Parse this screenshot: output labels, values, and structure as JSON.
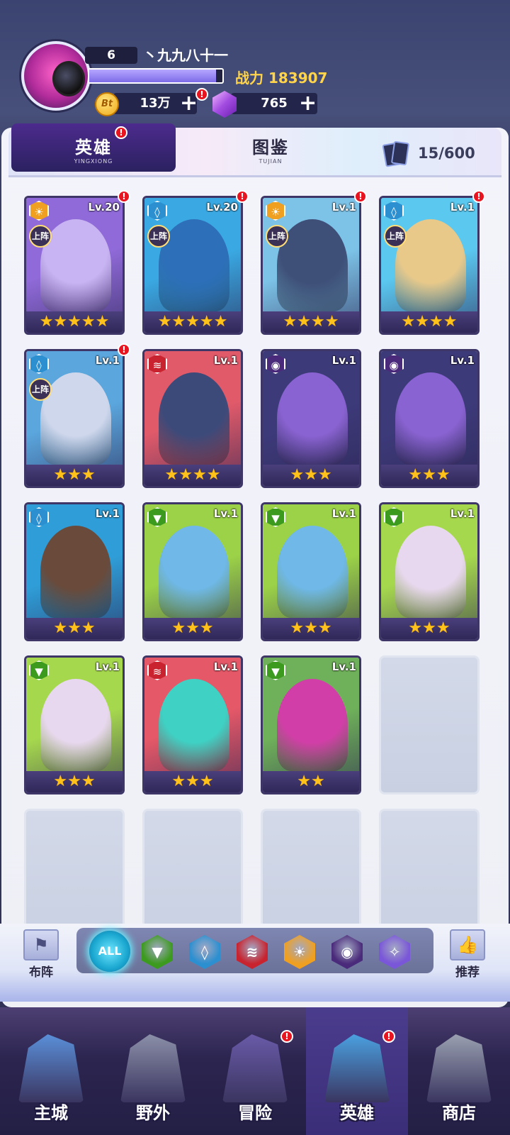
{
  "player": {
    "level": "6",
    "name": "丶九九八十一",
    "xp_fraction": 0.95,
    "power_label": "战力",
    "power_value": "183907",
    "coins": "13万",
    "gems": "765",
    "coin_symbol": "Bt",
    "plus": "+"
  },
  "tabs": {
    "heroes": "英雄",
    "heroes_sub": "YINGXIONG",
    "atlas": "图鉴",
    "atlas_sub": "TUJIAN",
    "card_count": "15/600"
  },
  "badge_text": "!",
  "deploy_label": "上阵",
  "star_char": "★",
  "heroes": [
    {
      "level": "Lv.20",
      "element": "sun",
      "stars": 5,
      "deployed": true,
      "badge": true,
      "bg": "#8f6ad8",
      "fig": "#c8b4f2"
    },
    {
      "level": "Lv.20",
      "element": "water",
      "stars": 5,
      "deployed": true,
      "badge": true,
      "bg": "#3aa9e3",
      "fig": "#2d6fb8"
    },
    {
      "level": "Lv.1",
      "element": "sun",
      "stars": 4,
      "deployed": true,
      "badge": true,
      "bg": "#7dc3e8",
      "fig": "#3e4f78"
    },
    {
      "level": "Lv.1",
      "element": "water",
      "stars": 4,
      "deployed": true,
      "badge": true,
      "bg": "#5bc8f0",
      "fig": "#e8c98a"
    },
    {
      "level": "Lv.1",
      "element": "water",
      "stars": 3,
      "deployed": true,
      "badge": true,
      "bg": "#5aa6dd",
      "fig": "#cfd7ec"
    },
    {
      "level": "Lv.1",
      "element": "fire",
      "stars": 4,
      "deployed": false,
      "badge": false,
      "bg": "#e05a6a",
      "fig": "#3c4a7a"
    },
    {
      "level": "Lv.1",
      "element": "dark",
      "stars": 3,
      "deployed": false,
      "badge": false,
      "bg": "#3d3a7a",
      "fig": "#8a63d2"
    },
    {
      "level": "Lv.1",
      "element": "dark",
      "stars": 3,
      "deployed": false,
      "badge": false,
      "bg": "#3d3a7a",
      "fig": "#8a63d2"
    },
    {
      "level": "Lv.1",
      "element": "water",
      "stars": 3,
      "deployed": false,
      "badge": false,
      "bg": "#2f9ed8",
      "fig": "#6a4a3a"
    },
    {
      "level": "Lv.1",
      "element": "nature",
      "stars": 3,
      "deployed": false,
      "badge": false,
      "bg": "#9cd248",
      "fig": "#6fb8e8"
    },
    {
      "level": "Lv.1",
      "element": "nature",
      "stars": 3,
      "deployed": false,
      "badge": false,
      "bg": "#9cd248",
      "fig": "#6fb8e8"
    },
    {
      "level": "Lv.1",
      "element": "nature",
      "stars": 3,
      "deployed": false,
      "badge": false,
      "bg": "#a6d84e",
      "fig": "#e8d8ef"
    },
    {
      "level": "Lv.1",
      "element": "nature",
      "stars": 3,
      "deployed": false,
      "badge": false,
      "bg": "#a6d84e",
      "fig": "#e8d8ef"
    },
    {
      "level": "Lv.1",
      "element": "fire",
      "stars": 3,
      "deployed": false,
      "badge": false,
      "bg": "#e45868",
      "fig": "#3fd1c4"
    },
    {
      "level": "Lv.1",
      "element": "nature",
      "stars": 2,
      "deployed": false,
      "badge": false,
      "bg": "#6fb05a",
      "fig": "#d23ea8"
    }
  ],
  "empty_slots": 5,
  "element_style": {
    "sun": {
      "color": "#f0a020",
      "glyph": "☀"
    },
    "water": {
      "color": "#2b8fd0",
      "glyph": "◊"
    },
    "fire": {
      "color": "#c8232e",
      "glyph": "≋"
    },
    "dark": {
      "color": "#4a2a7a",
      "glyph": "◉"
    },
    "nature": {
      "color": "#3c9a1e",
      "glyph": "▼"
    },
    "light": {
      "color": "#7a56d8",
      "glyph": "✧"
    }
  },
  "filters": {
    "formation_label": "布阵",
    "recommend_label": "推荐",
    "all_label": "ALL",
    "items": [
      "nature",
      "water",
      "fire",
      "sun",
      "dark",
      "light"
    ]
  },
  "nav": [
    {
      "label": "主城",
      "active": false,
      "badge": false,
      "color": "#5a8fd8"
    },
    {
      "label": "野外",
      "active": false,
      "badge": false,
      "color": "#8b8fa8"
    },
    {
      "label": "冒险",
      "active": false,
      "badge": true,
      "color": "#6a5aa8"
    },
    {
      "label": "英雄",
      "active": true,
      "badge": true,
      "color": "#4aa0e0"
    },
    {
      "label": "商店",
      "active": false,
      "badge": false,
      "color": "#9aa0b0"
    }
  ]
}
